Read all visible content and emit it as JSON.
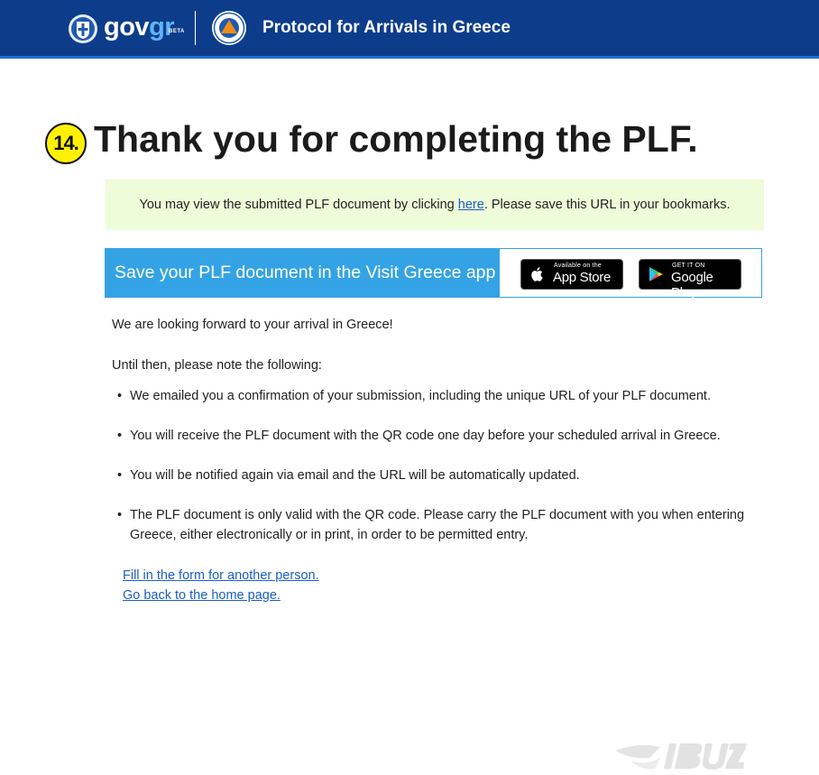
{
  "header": {
    "logo_gov": "gov",
    "logo_gr": "gr",
    "logo_beta": "BETA",
    "title": "Protocol for Arrivals in Greece"
  },
  "step": {
    "number": "14."
  },
  "page_title": "Thank you for completing the PLF.",
  "notice": {
    "before": "You may view the submitted PLF document by clicking ",
    "link": "here",
    "after": ". Please save this URL in your bookmarks."
  },
  "app_banner": {
    "text": "Save your PLF document in the Visit Greece app",
    "app_store_small": "Available on the",
    "app_store_big": "App Store",
    "google_small": "GET IT ON",
    "google_big": "Google Play"
  },
  "content": {
    "intro": "We are looking forward to your arrival in Greece!",
    "until": "Until then, please note the following:",
    "bullets": [
      "We emailed you a confirmation of your submission, including the unique URL of your PLF document.",
      "You will receive the PLF document with the QR code one day before your scheduled arrival in Greece.",
      "You will be notified again via email and the URL will be automatically updated.",
      "The PLF document is only valid with the QR code. Please carry the PLF document with you when entering Greece, either electronically or in print, in order to be permitted entry."
    ]
  },
  "links": {
    "another_person": "Fill in the form for another person.",
    "home": "Go back to the home page."
  },
  "icons": {
    "emblem": "greek-emblem-icon",
    "civil_protection": "civil-protection-logo",
    "apple": "apple-icon",
    "google_play": "google-play-icon"
  },
  "colors": {
    "header_bg": "#0d3d8a",
    "banner_bg": "#34a3e5",
    "notice_bg": "#eefcd9",
    "link": "#1a5fc4",
    "step_badge": "#fff200"
  }
}
